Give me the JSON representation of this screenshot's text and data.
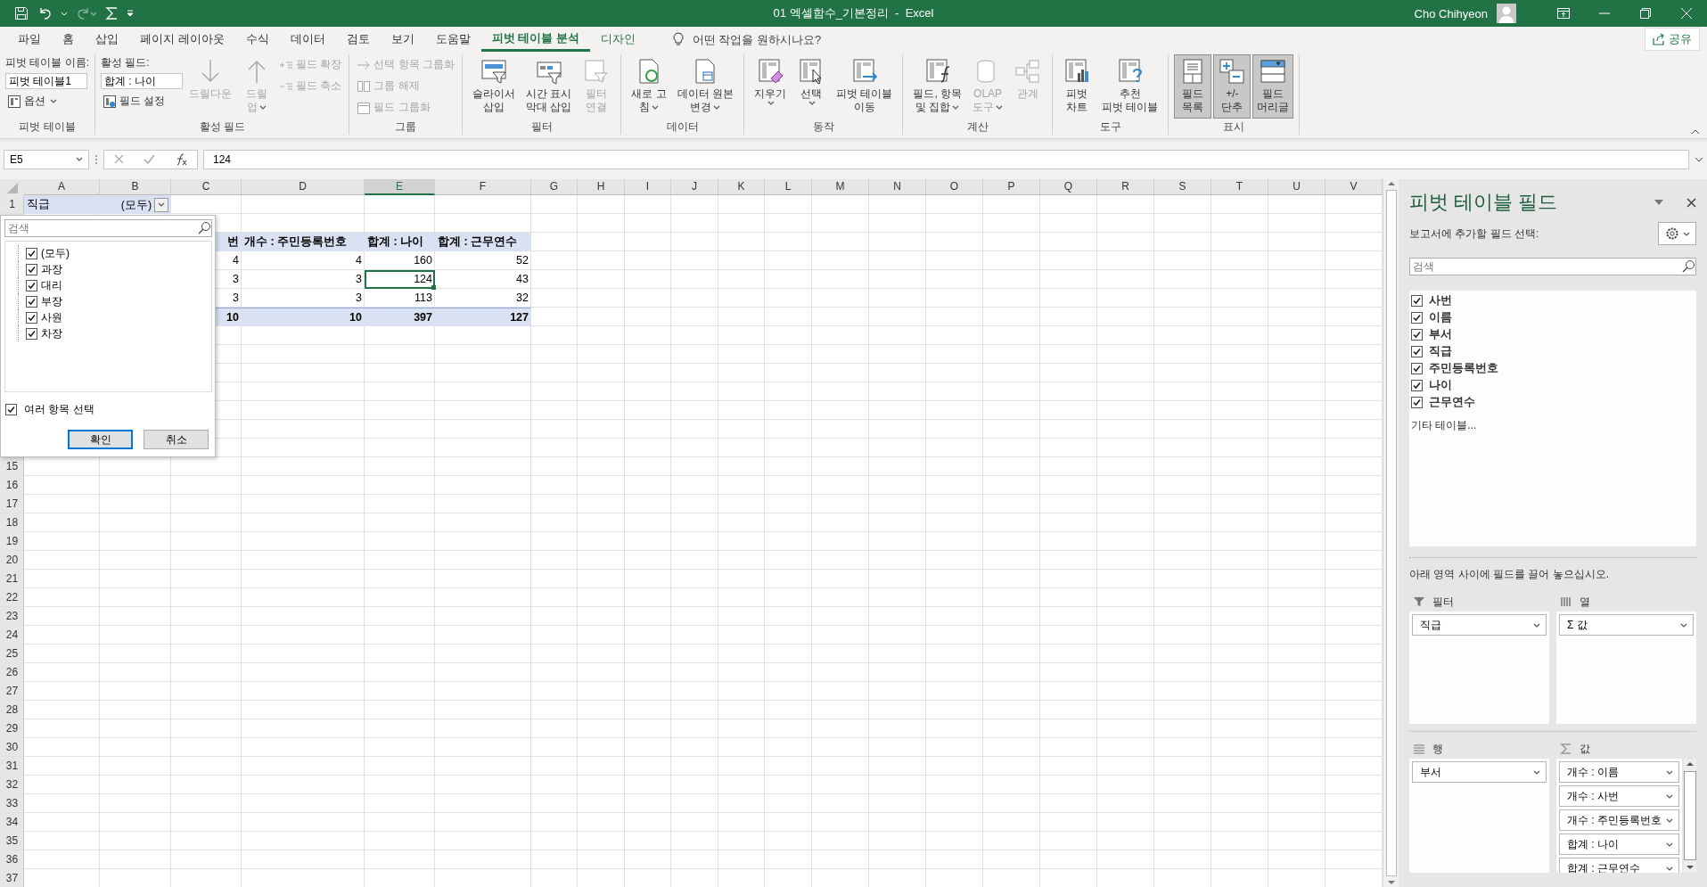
{
  "window": {
    "title": "01 엑셀함수_기본정리  -  Excel",
    "user": "Cho Chihyeon"
  },
  "tabs": [
    {
      "label": "파일",
      "selected": false,
      "contextual": false
    },
    {
      "label": "홈",
      "selected": false,
      "contextual": false
    },
    {
      "label": "삽입",
      "selected": false,
      "contextual": false
    },
    {
      "label": "페이지 레이아웃",
      "selected": false,
      "contextual": false
    },
    {
      "label": "수식",
      "selected": false,
      "contextual": false
    },
    {
      "label": "데이터",
      "selected": false,
      "contextual": false
    },
    {
      "label": "검토",
      "selected": false,
      "contextual": false
    },
    {
      "label": "보기",
      "selected": false,
      "contextual": false
    },
    {
      "label": "도움말",
      "selected": false,
      "contextual": false
    },
    {
      "label": "피벗 테이블 분석",
      "selected": true,
      "contextual": true
    },
    {
      "label": "디자인",
      "selected": false,
      "contextual": true
    }
  ],
  "tell_me": {
    "placeholder": "어떤 작업을 원하시나요?"
  },
  "share_button": {
    "label": "공유"
  },
  "ribbon": {
    "groups": [
      {
        "label": "피벗 테이블",
        "items": [
          {
            "kind": "stack",
            "children": [
              {
                "kind": "caption",
                "text": "피벗 테이블 이름:"
              },
              {
                "kind": "field",
                "value": "피벗 테이블1"
              },
              {
                "kind": "small",
                "label": "옵션",
                "caret": true,
                "disabled": false
              }
            ]
          }
        ]
      },
      {
        "label": "활성 필드",
        "items": [
          {
            "kind": "stack",
            "children": [
              {
                "kind": "caption",
                "text": "활성 필드:"
              },
              {
                "kind": "field",
                "value": "합계 : 나이"
              },
              {
                "kind": "small",
                "label": "필드 설정",
                "caret": false,
                "disabled": false
              }
            ]
          },
          {
            "kind": "big",
            "lines": [
              "드릴다운"
            ],
            "caret": false,
            "disabled": true,
            "on": false
          },
          {
            "kind": "big",
            "lines": [
              "드릴",
              "업"
            ],
            "caret": true,
            "disabled": true,
            "on": false
          },
          {
            "kind": "stack",
            "children": [
              {
                "kind": "small",
                "label": "필드 확장",
                "caret": false,
                "disabled": true
              },
              {
                "kind": "small",
                "label": "필드 축소",
                "caret": false,
                "disabled": true
              }
            ]
          }
        ]
      },
      {
        "label": "그룹",
        "items": [
          {
            "kind": "stack",
            "children": [
              {
                "kind": "small",
                "label": "선택 항목 그룹화",
                "caret": false,
                "disabled": true
              },
              {
                "kind": "small",
                "label": "그룹 해제",
                "caret": false,
                "disabled": true
              },
              {
                "kind": "small",
                "label": "필드 그룹화",
                "caret": false,
                "disabled": true
              }
            ]
          }
        ]
      },
      {
        "label": "필터",
        "items": [
          {
            "kind": "big",
            "lines": [
              "슬라이서",
              "삽입"
            ],
            "caret": false,
            "disabled": false,
            "on": false
          },
          {
            "kind": "big",
            "lines": [
              "시간 표시",
              "막대 삽입"
            ],
            "caret": false,
            "disabled": false,
            "on": false
          },
          {
            "kind": "big",
            "lines": [
              "필터",
              "연결"
            ],
            "caret": false,
            "disabled": true,
            "on": false
          }
        ]
      },
      {
        "label": "데이터",
        "items": [
          {
            "kind": "big",
            "lines": [
              "새로 고",
              "침"
            ],
            "caret": true,
            "disabled": false,
            "on": false
          },
          {
            "kind": "big",
            "lines": [
              "데이터 원본",
              "변경"
            ],
            "caret": true,
            "disabled": false,
            "on": false
          }
        ]
      },
      {
        "label": "동작",
        "items": [
          {
            "kind": "big",
            "lines": [
              "지우기"
            ],
            "caret": true,
            "disabled": false,
            "on": false
          },
          {
            "kind": "big",
            "lines": [
              "선택"
            ],
            "caret": true,
            "disabled": false,
            "on": false
          },
          {
            "kind": "big",
            "lines": [
              "피벗 테이블",
              "이동"
            ],
            "caret": false,
            "disabled": false,
            "on": false
          }
        ]
      },
      {
        "label": "계산",
        "items": [
          {
            "kind": "big",
            "lines": [
              "필드, 항목",
              "및 집합"
            ],
            "caret": true,
            "disabled": false,
            "on": false
          },
          {
            "kind": "big",
            "lines": [
              "OLAP",
              "도구"
            ],
            "caret": true,
            "disabled": true,
            "on": false
          },
          {
            "kind": "big",
            "lines": [
              "관계"
            ],
            "caret": false,
            "disabled": true,
            "on": false
          }
        ]
      },
      {
        "label": "도구",
        "items": [
          {
            "kind": "big",
            "lines": [
              "피벗",
              "차트"
            ],
            "caret": false,
            "disabled": false,
            "on": false
          },
          {
            "kind": "big",
            "lines": [
              "추천",
              "피벗 테이블"
            ],
            "caret": false,
            "disabled": false,
            "on": false
          }
        ]
      },
      {
        "label": "표시",
        "items": [
          {
            "kind": "big",
            "lines": [
              "필드",
              "목록"
            ],
            "caret": false,
            "disabled": false,
            "on": true
          },
          {
            "kind": "big",
            "lines": [
              "+/-",
              "단추"
            ],
            "caret": false,
            "disabled": false,
            "on": true
          },
          {
            "kind": "big",
            "lines": [
              "필드",
              "머리글"
            ],
            "caret": false,
            "disabled": false,
            "on": true
          }
        ]
      }
    ]
  },
  "formula_bar": {
    "name_box": "E5",
    "value": "124"
  },
  "sheet": {
    "columns": [
      {
        "label": "A",
        "selected": false
      },
      {
        "label": "B",
        "selected": false
      },
      {
        "label": "C",
        "selected": false
      },
      {
        "label": "D",
        "selected": false
      },
      {
        "label": "E",
        "selected": true
      },
      {
        "label": "F",
        "selected": false
      },
      {
        "label": "G",
        "selected": false
      },
      {
        "label": "H",
        "selected": false
      },
      {
        "label": "I",
        "selected": false
      },
      {
        "label": "J",
        "selected": false
      },
      {
        "label": "K",
        "selected": false
      },
      {
        "label": "L",
        "selected": false
      },
      {
        "label": "M",
        "selected": false
      },
      {
        "label": "N",
        "selected": false
      },
      {
        "label": "O",
        "selected": false
      },
      {
        "label": "P",
        "selected": false
      },
      {
        "label": "Q",
        "selected": false
      },
      {
        "label": "R",
        "selected": false
      },
      {
        "label": "S",
        "selected": false
      },
      {
        "label": "T",
        "selected": false
      },
      {
        "label": "U",
        "selected": false
      },
      {
        "label": "V",
        "selected": false
      }
    ],
    "rows": [
      {
        "header": "1",
        "kind": "filter",
        "cells": [
          {
            "text": "직급",
            "selected": false
          },
          {
            "text": "(모두)",
            "selected": false
          }
        ]
      },
      {
        "kind": "blank"
      },
      {
        "kind": "header",
        "cells": [
          {
            "text": "번",
            "selected": false
          },
          {
            "text": "개수 : 주민등록번호",
            "selected": false
          },
          {
            "text": "합계 : 나이",
            "selected": false
          },
          {
            "text": "합계 : 근무연수",
            "selected": false
          }
        ]
      },
      {
        "kind": "data",
        "cells": [
          {
            "text": "4",
            "selected": false
          },
          {
            "text": "4",
            "selected": false
          },
          {
            "text": "160",
            "selected": false
          },
          {
            "text": "52",
            "selected": false
          }
        ]
      },
      {
        "kind": "data",
        "cells": [
          {
            "text": "3",
            "selected": false
          },
          {
            "text": "3",
            "selected": false
          },
          {
            "text": "124",
            "selected": true
          },
          {
            "text": "43",
            "selected": false
          }
        ]
      },
      {
        "kind": "data",
        "cells": [
          {
            "text": "3",
            "selected": false
          },
          {
            "text": "3",
            "selected": false
          },
          {
            "text": "113",
            "selected": false
          },
          {
            "text": "32",
            "selected": false
          }
        ]
      },
      {
        "kind": "total",
        "cells": [
          {
            "text": "10",
            "selected": false
          },
          {
            "text": "10",
            "selected": false
          },
          {
            "text": "397",
            "selected": false
          },
          {
            "text": "127",
            "selected": false
          }
        ]
      },
      {
        "kind": "blank"
      },
      {
        "kind": "blank"
      },
      {
        "kind": "blank"
      },
      {
        "kind": "blank"
      },
      {
        "kind": "blank"
      },
      {
        "kind": "blank"
      },
      {
        "kind": "blank"
      },
      {
        "header": "15",
        "kind": "blank"
      },
      {
        "header": "16",
        "kind": "blank"
      },
      {
        "header": "17",
        "kind": "blank"
      },
      {
        "header": "18",
        "kind": "blank"
      },
      {
        "header": "19",
        "kind": "blank"
      },
      {
        "header": "20",
        "kind": "blank"
      },
      {
        "header": "21",
        "kind": "blank"
      },
      {
        "header": "22",
        "kind": "blank"
      },
      {
        "header": "23",
        "kind": "blank"
      },
      {
        "header": "24",
        "kind": "blank"
      },
      {
        "header": "25",
        "kind": "blank"
      },
      {
        "header": "26",
        "kind": "blank"
      },
      {
        "header": "27",
        "kind": "blank"
      },
      {
        "header": "28",
        "kind": "blank"
      },
      {
        "header": "29",
        "kind": "blank"
      },
      {
        "header": "30",
        "kind": "blank"
      },
      {
        "header": "31",
        "kind": "blank"
      },
      {
        "header": "32",
        "kind": "blank"
      },
      {
        "header": "33",
        "kind": "blank"
      },
      {
        "header": "34",
        "kind": "blank"
      },
      {
        "header": "35",
        "kind": "blank"
      },
      {
        "header": "36",
        "kind": "blank"
      },
      {
        "header": "37",
        "kind": "blank"
      }
    ]
  },
  "filter_dropdown": {
    "search": {
      "placeholder": "검색"
    },
    "items": [
      {
        "label": "(모두)",
        "checked": true
      },
      {
        "label": "과장",
        "checked": true
      },
      {
        "label": "대리",
        "checked": true
      },
      {
        "label": "부장",
        "checked": true
      },
      {
        "label": "사원",
        "checked": true
      },
      {
        "label": "차장",
        "checked": true
      }
    ],
    "multi_select": {
      "label": "여러 항목 선택",
      "checked": true
    },
    "buttons": [
      {
        "label": "확인",
        "kind": "default"
      },
      {
        "label": "취소",
        "kind": "normal"
      }
    ]
  },
  "pane": {
    "title": "피벗 테이블 필드",
    "subtitle": "보고서에 추가할 필드 선택:",
    "search": {
      "placeholder": "검색"
    },
    "fields": [
      {
        "label": "사번",
        "checked": true
      },
      {
        "label": "이름",
        "checked": true
      },
      {
        "label": "부서",
        "checked": true
      },
      {
        "label": "직급",
        "checked": true
      },
      {
        "label": "주민등록번호",
        "checked": true
      },
      {
        "label": "나이",
        "checked": true
      },
      {
        "label": "근무연수",
        "checked": true
      }
    ],
    "more_tables": "기타 테이블...",
    "instruction": "아래 영역 사이에 필드를 끌어 놓으십시오.",
    "areas": [
      {
        "kind": "filter",
        "label": "필터",
        "items": [
          "직급"
        ]
      },
      {
        "kind": "columns",
        "label": "열",
        "items": [
          "Σ 값"
        ]
      },
      {
        "kind": "rows",
        "label": "행",
        "items": [
          "부서"
        ]
      },
      {
        "kind": "values",
        "label": "값",
        "items": [
          "개수 : 이름",
          "개수 : 사번",
          "개수 : 주민등록번호",
          "합계 : 나이",
          "합계 : 근무연수"
        ]
      }
    ]
  }
}
